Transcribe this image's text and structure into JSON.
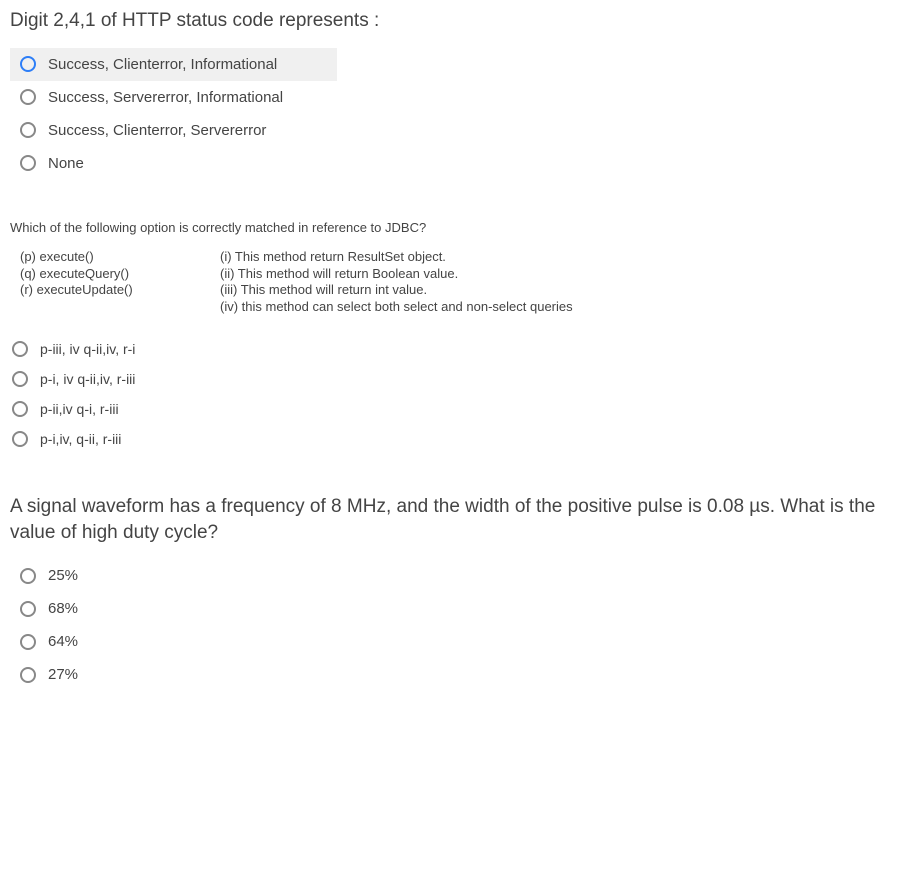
{
  "q1": {
    "title": "Digit 2,4,1 of HTTP status code represents :",
    "options": [
      "Success, Clienterror, Informational",
      "Success, Servererror, Informational",
      "Success, Clienterror, Servererror",
      "None"
    ]
  },
  "q2": {
    "title": "Which of the following option is correctly matched in reference  to JDBC?",
    "left": [
      "(p)  execute()",
      "(q)  executeQuery()",
      "(r)  executeUpdate()"
    ],
    "right": [
      "(i) This method return ResultSet object.",
      "(ii) This method will return Boolean value.",
      "(iii) This method will return int value.",
      "(iv) this method can select both select and non-select queries"
    ],
    "options": [
      "p-iii,  iv  q-ii,iv, r-i",
      "p-i,  iv  q-ii,iv, r-iii",
      "p-ii,iv  q-i,  r-iii",
      "p-i,iv,  q-ii,   r-iii"
    ]
  },
  "q3": {
    "title": "A signal waveform has a frequency of 8 MHz, and the width of the positive pulse is 0.08 µs. What is the value of high duty cycle?",
    "options": [
      "25%",
      "68%",
      "64%",
      "27%"
    ]
  }
}
